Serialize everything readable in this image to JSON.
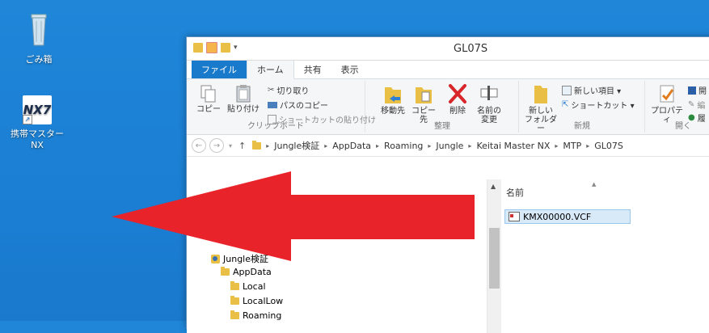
{
  "desktop": {
    "recycle_bin_label": "ごみ箱",
    "nx_icon_text": "NX7",
    "nx_label": "携帯マスターNX"
  },
  "window": {
    "title": "GL07S",
    "tabs": [
      "ファイル",
      "ホーム",
      "共有",
      "表示"
    ],
    "ribbon": {
      "clipboard": {
        "copy": "コピー",
        "paste": "貼り付け",
        "cut": "切り取り",
        "copy_path": "パスのコピー",
        "paste_shortcut": "ショートカットの貼り付け",
        "caption": "クリップボード"
      },
      "organize": {
        "move_to": "移動先",
        "copy_to": "コピー先",
        "delete": "削除",
        "rename_1": "名前の",
        "rename_2": "変更",
        "caption": "整理"
      },
      "new": {
        "new_folder_1": "新しい",
        "new_folder_2": "フォルダー",
        "new_item": "新しい項目 ▾",
        "shortcut": "ショートカット ▾",
        "caption": "新規"
      },
      "open": {
        "properties": "プロパティ",
        "open": "開",
        "edit": "編",
        "history": "履",
        "caption": "開く"
      }
    },
    "address": {
      "crumbs": [
        "Jungle検証",
        "AppData",
        "Roaming",
        "Jungle",
        "Keitai Master NX",
        "MTP",
        "GL07S"
      ]
    },
    "nav_tree": [
      {
        "label": "Jungle検証"
      },
      {
        "label": "AppData"
      },
      {
        "label": "Local"
      },
      {
        "label": "LocalLow"
      },
      {
        "label": "Roaming"
      }
    ],
    "content": {
      "column_name": "名前",
      "files": [
        {
          "name": "KMX00000.VCF"
        }
      ]
    }
  },
  "overlay": {
    "arrow_color": "#e8232a"
  }
}
